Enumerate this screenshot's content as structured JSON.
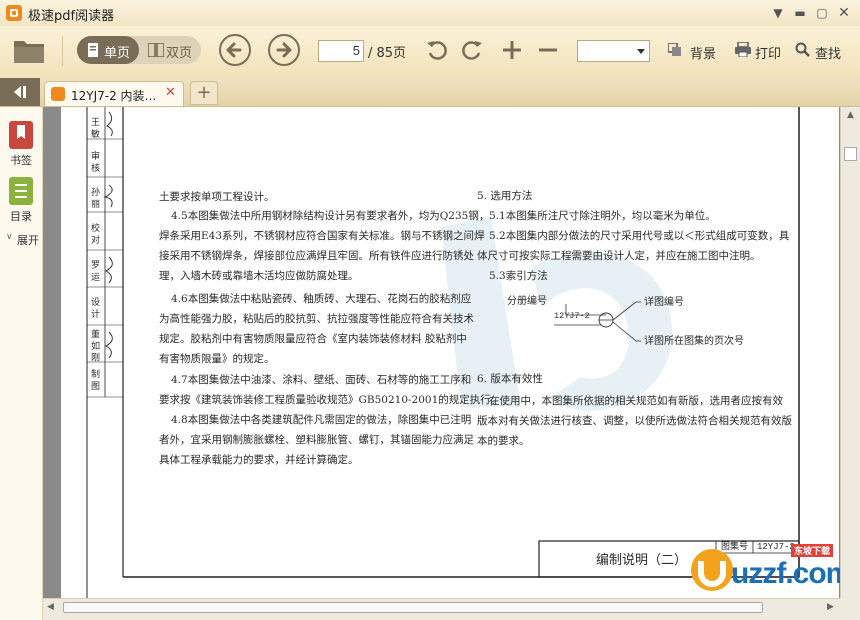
{
  "app": {
    "title": "极速pdf阅读器"
  },
  "toolbar": {
    "single_page": "单页",
    "double_page": "双页",
    "current_page": "5",
    "total_pages": "/ 85页",
    "zoom_value": "",
    "background": "背景",
    "print": "打印",
    "search": "查找"
  },
  "tabs": [
    {
      "label": "12YJ7-2 内装…"
    }
  ],
  "sidebar": {
    "bookmarks": "书签",
    "outline": "目录",
    "expand": "展开"
  },
  "document": {
    "side_table": [
      "王 敏",
      "审 核",
      "孙 丽",
      "校 对",
      "罗 运",
      "设 计",
      "董 如 刚",
      "制 图"
    ],
    "left_column": [
      "土要求按单项工程设计。",
      "4.5本图集做法中所用钢材除结构设计另有要求者外，均为Q235钢，",
      "焊条采用E43系列，不锈钢材应符合国家有关标准。钢与不锈钢之间焊",
      "接采用不锈钢焊条，焊接部位应满焊且牢固。所有铁件应进行防锈处",
      "理，入墙木砖或靠墙木活均应做防腐处理。",
      "4.6本图集做法中粘贴瓷砖、釉质砖、大理石、花岗石的胶粘剂应",
      "为高性能强力胶，粘贴后的胶抗剪、抗拉强度等性能应符合有关技术",
      "规定。胶粘剂中有害物质限量应符合《室内装饰装修材料  胶粘剂中",
      "有害物质限量》的规定。",
      "4.7本图集做法中油漆、涂料、壁纸、面砖、石材等的施工工序和",
      "要求按《建筑装饰装修工程质量验收规范》GB50210-2001的规定执行。",
      "4.8本图集做法中各类建筑配件凡需固定的做法，除图集中已注明",
      "者外，宜采用钢制膨胀螺栓、塑料膨胀管、螺钉，其锚固能力应满足",
      "具体工程承载能力的要求，并经计算确定。"
    ],
    "right_column": [
      "5. 选用方法",
      "5.1本图集所注尺寸除注明外，均以毫米为单位。",
      "5.2本图集内部分做法的尺寸采用代号或以＜形式组成可变数，具",
      "体尺寸可按实际工程需要由设计人定，并应在施工图中注明。",
      "5.3索引方法"
    ],
    "index_diagram": {
      "group_label": "分册编号",
      "code": "12YJ7-2",
      "detail_label": "详图编号",
      "page_label": "详图所在图集的页次号"
    },
    "section6": [
      "6. 版本有效性",
      "在使用中，本图集所依据的相关规范如有新版，选用者应按有效",
      "版本对有关做法进行核查、调整，以使所选做法符合相关规范有效版",
      "本的要求。"
    ],
    "title_block": {
      "title": "编制说明（二）",
      "atlas_label": "图集号",
      "atlas_no": "12YJ7-2"
    }
  },
  "watermark": {
    "brand": "uzzf.com",
    "tag": "东坡下载"
  },
  "colors": {
    "accent": "#f08a1c",
    "toolbar_dark": "#7a6d58"
  }
}
